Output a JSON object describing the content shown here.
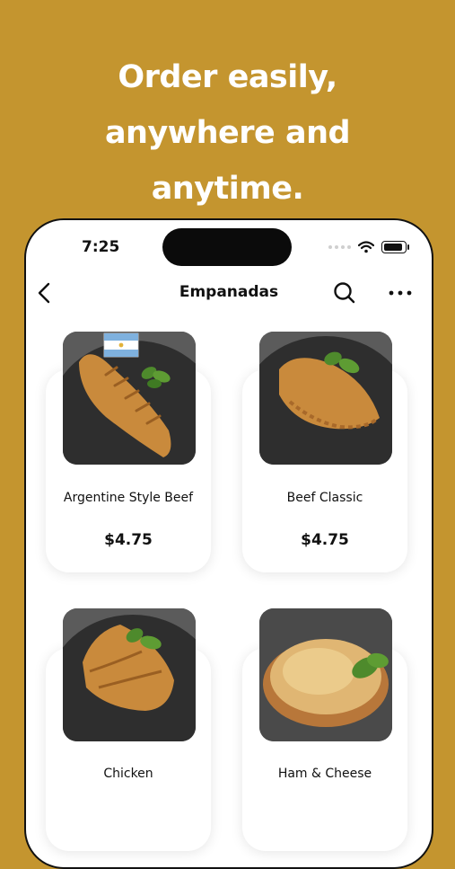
{
  "headline": {
    "line1": "Order easily,",
    "line2": "anywhere and",
    "line3": "anytime."
  },
  "status": {
    "time": "7:25"
  },
  "navbar": {
    "title": "Empanadas"
  },
  "products": [
    {
      "name": "Argentine Style Beef",
      "price": "$4.75"
    },
    {
      "name": "Beef Classic",
      "price": "$4.75"
    },
    {
      "name": "Chicken",
      "price": ""
    },
    {
      "name": "Ham & Cheese",
      "price": ""
    }
  ]
}
